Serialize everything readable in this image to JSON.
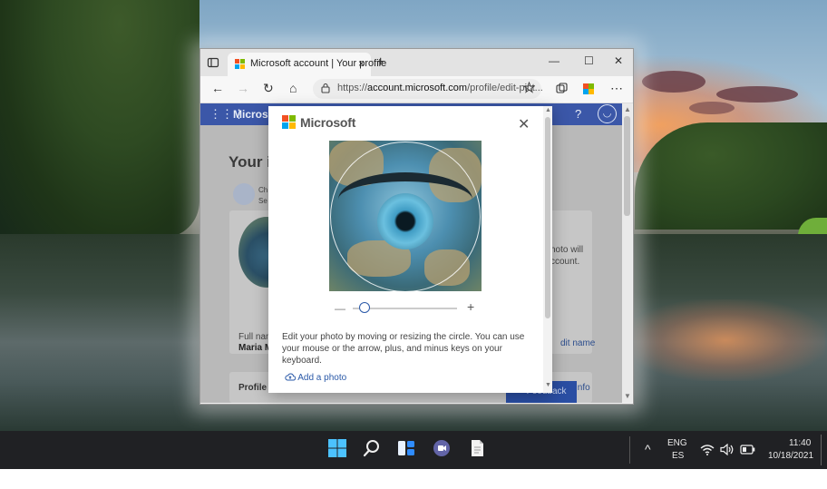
{
  "browser": {
    "tab_title": "Microsoft account | Your profile",
    "tab_close": "×",
    "new_tab": "+",
    "window_minimize": "—",
    "window_maximize": "☐",
    "window_close": "✕",
    "back": "←",
    "forward": "→",
    "refresh": "↻",
    "home": "⌂",
    "url_prefix": "https://",
    "url_host": "account.microsoft.com",
    "url_path": "/profile/edit-pict...",
    "more": "⋯"
  },
  "page": {
    "header_brand": "Microsoft",
    "help": "?",
    "heading": "Your i",
    "change_text": "Ch",
    "change_sub": "Se",
    "photo_text_1": "hoto will",
    "photo_text_2": "ccount.",
    "full_name_label": "Full nam",
    "full_name_value": "Maria M",
    "edit_name": "dit name",
    "profile_info": "Profile i",
    "info_link": "Info",
    "feedback": "Feedback"
  },
  "modal": {
    "brand": "Microsoft",
    "close": "✕",
    "zoom_minus": "—",
    "zoom_plus": "+",
    "zoom_level": 0.1,
    "instructions": "Edit your photo by moving or resizing the circle. You can use your mouse or the arrow, plus, and minus keys on your keyboard.",
    "add_photo": "Add a photo"
  },
  "taskbar": {
    "lang_1": "ENG",
    "lang_2": "ES",
    "time": "11:40",
    "date": "10/18/2021",
    "chevron": "^"
  },
  "colors": {
    "ms_red": "#f25022",
    "ms_green": "#7fba00",
    "ms_blue": "#00a4ef",
    "ms_yellow": "#ffb900",
    "accent": "#2a59a8",
    "page_header": "#3b57a8"
  }
}
